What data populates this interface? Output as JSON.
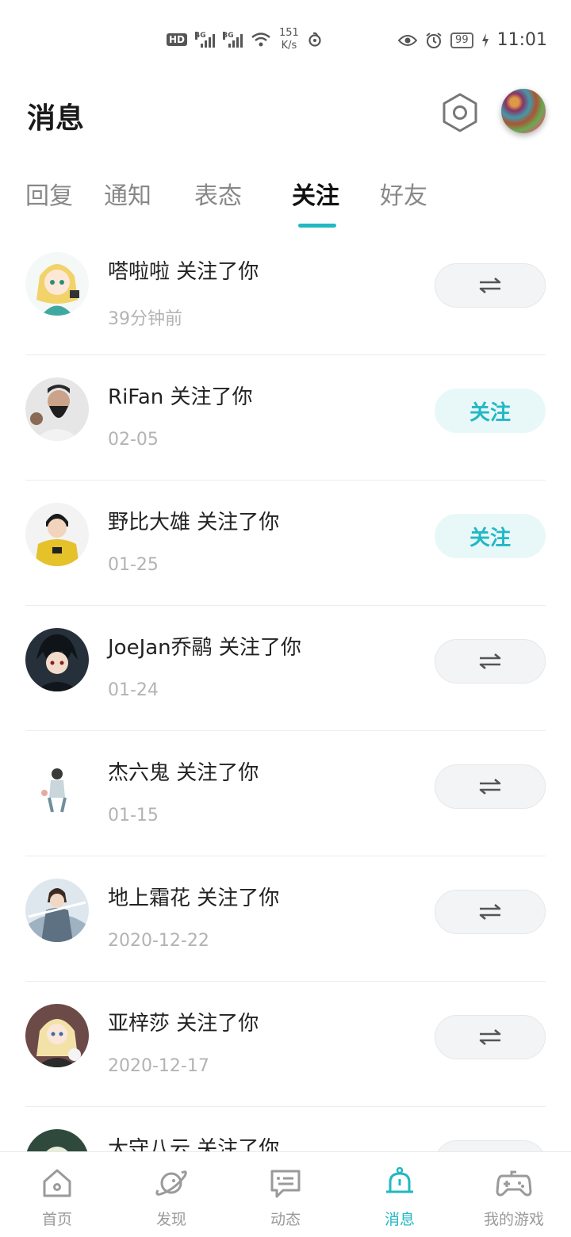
{
  "status_bar": {
    "hd": "HD",
    "net1": "4G",
    "net2": "3G",
    "speed_value": "151",
    "speed_unit": "K/s",
    "battery": "99",
    "time": "11:01"
  },
  "header": {
    "title": "消息"
  },
  "tabs": [
    {
      "label": "回复"
    },
    {
      "label": "通知"
    },
    {
      "label": "表态"
    },
    {
      "label": "关注"
    },
    {
      "label": "好友"
    }
  ],
  "active_tab": "关注",
  "follows": [
    {
      "name": "嗒啦啦 关注了你",
      "date": "39分钟前",
      "button": "mutual"
    },
    {
      "name": "RiFan 关注了你",
      "date": "02-05",
      "button": "follow",
      "button_label": "关注"
    },
    {
      "name": "野比大雄 关注了你",
      "date": "01-25",
      "button": "follow",
      "button_label": "关注"
    },
    {
      "name": "JoeJan乔鹝 关注了你",
      "date": "01-24",
      "button": "mutual"
    },
    {
      "name": "杰六鬼 关注了你",
      "date": "01-15",
      "button": "mutual"
    },
    {
      "name": "地上霜花 关注了你",
      "date": "2020-12-22",
      "button": "mutual"
    },
    {
      "name": "亚梓莎 关注了你",
      "date": "2020-12-17",
      "button": "mutual"
    },
    {
      "name": "大守八云 关注了你",
      "date": "",
      "button": "mutual"
    }
  ],
  "bottom_nav": [
    {
      "label": "首页",
      "icon": "home-icon"
    },
    {
      "label": "发现",
      "icon": "planet-icon"
    },
    {
      "label": "动态",
      "icon": "chat-icon"
    },
    {
      "label": "消息",
      "icon": "bell-icon"
    },
    {
      "label": "我的游戏",
      "icon": "gamepad-icon"
    }
  ],
  "colors": {
    "accent": "#22b8c4",
    "follow_bg": "#e8f8f9",
    "mutual_bg": "#f3f4f6"
  }
}
